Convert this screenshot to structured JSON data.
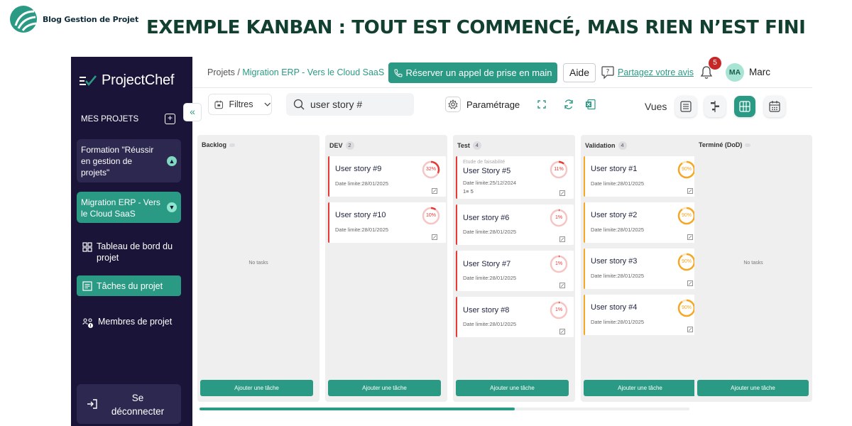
{
  "banner": {
    "brand_name": "Blog Gestion de Projet",
    "headline": "EXEMPLE KANBAN : TOUT EST COMMENCÉ, MAIS RIEN N’EST FINI"
  },
  "colors": {
    "sidebar_bg": "#1a1538",
    "accent": "#2b9a84",
    "card_red": "#e53935",
    "card_orange": "#f5a623",
    "headline": "#12402f",
    "badge": "#c62828"
  },
  "sidebar": {
    "app_name": "ProjectChef",
    "my_projects": "MES PROJETS",
    "projects": [
      {
        "label": "Formation \"Réussir en gestion de projets\""
      },
      {
        "label": "Migration ERP - Vers le Cloud SaaS"
      }
    ],
    "nav": [
      {
        "label": "Tableau de bord du projet",
        "icon": "grid-icon"
      },
      {
        "label": "Tâches du projet",
        "icon": "list-icon"
      },
      {
        "label": "Membres de projet",
        "icon": "team-icon"
      }
    ],
    "logout_line1": "Se",
    "logout_line2": "déconnecter",
    "collapse_glyph": "«"
  },
  "topbar": {
    "breadcrumb_root": "Projets",
    "breadcrumb_sep": " / ",
    "breadcrumb_current": "Migration ERP - Vers le Cloud SaaS",
    "call_button": "Réserver un appel de prise en main",
    "help_button": "Aide",
    "share_link": "Partagez votre avis",
    "notifications": "5",
    "avatar_initials": "MA",
    "username": "Marc"
  },
  "toolbar": {
    "filters_label": "Filtres",
    "search_value": "user story #",
    "settings_label": "Paramétrage",
    "views_label": "Vues",
    "active_view": "kanban"
  },
  "board": {
    "no_tasks": "No tasks",
    "add_task": "Ajouter une tâche",
    "columns": [
      {
        "name": "Backlog",
        "count": "",
        "cards": []
      },
      {
        "name": "DEV",
        "count": "2",
        "cards": [
          {
            "title": "User story #9",
            "date": "Date limite:28/01/2025",
            "progress_label": "32%",
            "progress": 32,
            "color": "red"
          },
          {
            "title": "User story #10",
            "date": "Date limite:28/01/2025",
            "progress_label": "10%",
            "progress": 10,
            "color": "red"
          }
        ]
      },
      {
        "name": "Test",
        "count": "4",
        "cards": [
          {
            "subtitle": "Etude de faisabilité",
            "title": "User Story #5",
            "date": "Date limite:25/12/2024",
            "extra": "1≡ 5",
            "progress_label": "11%",
            "progress": 11,
            "color": "red"
          },
          {
            "title": "User story #6",
            "date": "Date limite:28/01/2025",
            "progress_label": "1%",
            "progress": 1,
            "color": "red"
          },
          {
            "title": "User Story #7",
            "date": "Date limite:28/01/2025",
            "progress_label": "1%",
            "progress": 1,
            "color": "red"
          },
          {
            "title": "User story #8",
            "date": "Date limite:28/01/2025",
            "progress_label": "1%",
            "progress": 1,
            "color": "red"
          }
        ]
      },
      {
        "name": "Validation",
        "count": "4",
        "cards": [
          {
            "title": "User story #1",
            "date": "Date limite:28/01/2025",
            "progress_label": "90%",
            "progress": 90,
            "color": "orange"
          },
          {
            "title": "User story #2",
            "date": "Date limite:28/01/2025",
            "progress_label": "90%",
            "progress": 90,
            "color": "orange"
          },
          {
            "title": "User story #3",
            "date": "Date limite:28/01/2025",
            "progress_label": "90%",
            "progress": 90,
            "color": "orange"
          },
          {
            "title": "User story #4",
            "date": "Date limite:28/01/2025",
            "progress_label": "90%",
            "progress": 90,
            "color": "orange"
          }
        ]
      },
      {
        "name": "Terminé (DoD)",
        "count": "",
        "cards": []
      }
    ],
    "scroll_position": 0.64
  }
}
